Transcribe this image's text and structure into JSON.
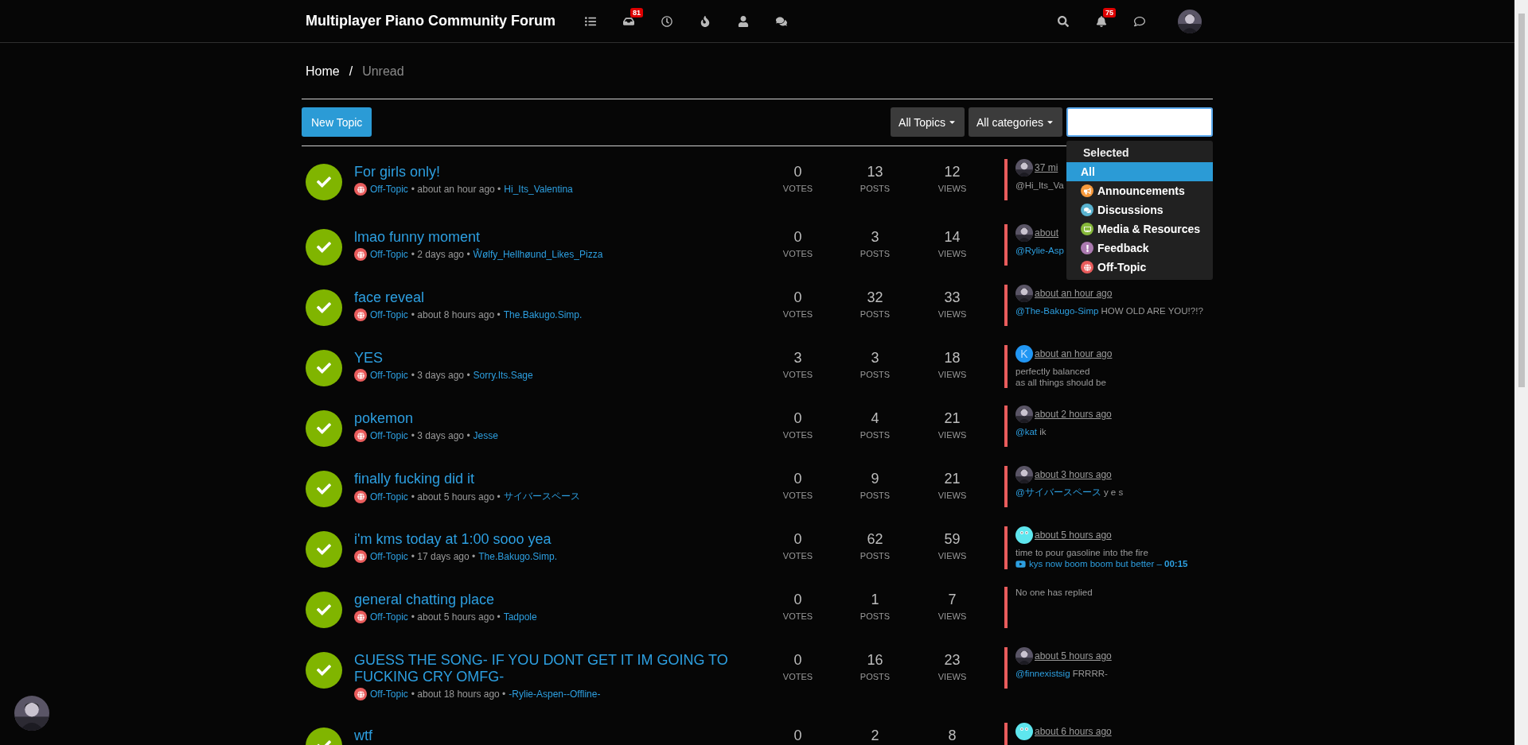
{
  "header": {
    "title": "Multiplayer Piano Community Forum",
    "nav": [
      {
        "kind": "categories"
      },
      {
        "kind": "unread",
        "badge": "81"
      },
      {
        "kind": "recent"
      },
      {
        "kind": "popular"
      },
      {
        "kind": "users"
      },
      {
        "kind": "groups"
      }
    ],
    "tools": [
      {
        "kind": "search"
      },
      {
        "kind": "notifications",
        "badge": "75"
      },
      {
        "kind": "chats"
      }
    ],
    "avatar": {
      "kind": "picture"
    }
  },
  "breadcrumb": [
    {
      "label": "Home",
      "selected": false
    },
    {
      "separator": "/",
      "label": "Unread",
      "selected": true
    }
  ],
  "toolbar": {
    "new_topic": "New Topic",
    "filters": [
      "All Topics",
      "All categories"
    ],
    "category_search": {
      "focused": true
    }
  },
  "category_menu": {
    "heading": "Selected",
    "items": [
      {
        "label": "All",
        "selected": true
      },
      {
        "label": "Announcements",
        "color": "#f79a3c",
        "selected": false,
        "kind": "bullhorn"
      },
      {
        "label": "Discussions",
        "color": "#59b3d0",
        "selected": false,
        "kind": "comments"
      },
      {
        "label": "Media & Resources",
        "color": "#86b83a",
        "selected": false,
        "kind": "media"
      },
      {
        "label": "Feedback",
        "color": "#ab7ab0",
        "selected": false,
        "kind": "exclamation"
      },
      {
        "label": "Off-Topic",
        "color": "#e95c5c",
        "selected": false,
        "kind": "globe"
      }
    ]
  },
  "topics": [
    {
      "title": "For girls only!",
      "category": "Off-Topic",
      "time": "• about an hour ago •",
      "author": "Hi_Its_Valentina",
      "stats": [
        {
          "value": "0",
          "label": "VOTES"
        },
        {
          "value": "13",
          "label": "POSTS"
        },
        {
          "value": "12",
          "label": "VIEWS"
        }
      ],
      "teaser": {
        "kind": "reply",
        "avatar": {
          "kind": "picture"
        },
        "time": "37 mi",
        "lines": [
          "@Hi_Its_Va"
        ]
      }
    },
    {
      "title": "lmao funny moment",
      "category": "Off-Topic",
      "time": "• 2 days ago •",
      "author": "Ŵølfy_Hellhøund_Likes_Pizza",
      "stats": [
        {
          "value": "0",
          "label": "VOTES"
        },
        {
          "value": "3",
          "label": "POSTS"
        },
        {
          "value": "14",
          "label": "VIEWS"
        }
      ],
      "teaser": {
        "kind": "reply",
        "avatar": {
          "kind": "picture"
        },
        "time": "about",
        "mention": "@Rylie-Asp"
      }
    },
    {
      "title": "face reveal",
      "category": "Off-Topic",
      "time": "• about 8 hours ago •",
      "author": "The.Bakugo.Simp.",
      "stats": [
        {
          "value": "0",
          "label": "VOTES"
        },
        {
          "value": "32",
          "label": "POSTS"
        },
        {
          "value": "33",
          "label": "VIEWS"
        }
      ],
      "teaser": {
        "kind": "reply",
        "avatar": {
          "kind": "picture"
        },
        "time": "about an hour ago",
        "mention": "@The-Bakugo-Simp",
        "lines": [
          "HOW OLD ARE YOU!?!?"
        ]
      }
    },
    {
      "title": "YES",
      "category": "Off-Topic",
      "time": "• 3 days ago •",
      "author": "Sorry.Its.Sage",
      "stats": [
        {
          "value": "3",
          "label": "VOTES"
        },
        {
          "value": "3",
          "label": "POSTS"
        },
        {
          "value": "18",
          "label": "VIEWS"
        }
      ],
      "teaser": {
        "kind": "reply",
        "avatar": {
          "kind": "letter",
          "letter": "K"
        },
        "time": "about an hour ago",
        "lines": [
          "perfectly balanced",
          "as all things should be"
        ]
      }
    },
    {
      "title": "pokemon",
      "category": "Off-Topic",
      "time": "• 3 days ago •",
      "author": "Jesse",
      "stats": [
        {
          "value": "0",
          "label": "VOTES"
        },
        {
          "value": "4",
          "label": "POSTS"
        },
        {
          "value": "21",
          "label": "VIEWS"
        }
      ],
      "teaser": {
        "kind": "reply",
        "avatar": {
          "kind": "picture"
        },
        "time": "about 2 hours ago",
        "mention": "@kat",
        "lines": [
          "ik"
        ]
      }
    },
    {
      "title": "finally fucking did it",
      "category": "Off-Topic",
      "time": "• about 5 hours ago •",
      "author": "サイバースペース",
      "stats": [
        {
          "value": "0",
          "label": "VOTES"
        },
        {
          "value": "9",
          "label": "POSTS"
        },
        {
          "value": "21",
          "label": "VIEWS"
        }
      ],
      "teaser": {
        "kind": "reply",
        "avatar": {
          "kind": "picture"
        },
        "time": "about 3 hours ago",
        "mention": "@サイバースペース",
        "lines": [
          "y e s"
        ]
      }
    },
    {
      "title": "i'm kms today at 1:00 sooo yea",
      "category": "Off-Topic",
      "time": "• 17 days ago •",
      "author": "The.Bakugo.Simp.",
      "stats": [
        {
          "value": "0",
          "label": "VOTES"
        },
        {
          "value": "62",
          "label": "POSTS"
        },
        {
          "value": "59",
          "label": "VIEWS"
        }
      ],
      "teaser": {
        "kind": "reply",
        "avatar": {
          "kind": "ghost"
        },
        "time": "about 5 hours ago",
        "lines": [
          "time to pour gasoline into the fire"
        ],
        "video": "kys now boom boom but better – **00:15**"
      }
    },
    {
      "title": "general chatting place",
      "category": "Off-Topic",
      "time": "• about 5 hours ago •",
      "author": "Tadpole",
      "stats": [
        {
          "value": "0",
          "label": "VOTES"
        },
        {
          "value": "1",
          "label": "POSTS"
        },
        {
          "value": "7",
          "label": "VIEWS"
        }
      ],
      "teaser": {
        "kind": "none",
        "text": "No one has replied"
      }
    },
    {
      "title": "GUESS THE SONG- IF YOU DONT GET IT IM GOING TO FUCKING CRY OMFG-",
      "category": "Off-Topic",
      "time": "• about 18 hours ago •",
      "author": "-Rylie-Aspen--Offline-",
      "stats": [
        {
          "value": "0",
          "label": "VOTES"
        },
        {
          "value": "16",
          "label": "POSTS"
        },
        {
          "value": "23",
          "label": "VIEWS"
        }
      ],
      "teaser": {
        "kind": "reply",
        "avatar": {
          "kind": "picture"
        },
        "time": "about 5 hours ago",
        "mention": "@finnexistsig",
        "lines": [
          "FRRRR-"
        ]
      }
    },
    {
      "title": "wtf",
      "stats": [
        {
          "value": "0"
        },
        {
          "value": "2"
        },
        {
          "value": "8"
        }
      ],
      "teaser": {
        "kind": "reply",
        "avatar": {
          "kind": "ghost"
        },
        "time": "about 6 hours ago"
      }
    }
  ],
  "floating_avatar": {
    "kind": "picture"
  }
}
